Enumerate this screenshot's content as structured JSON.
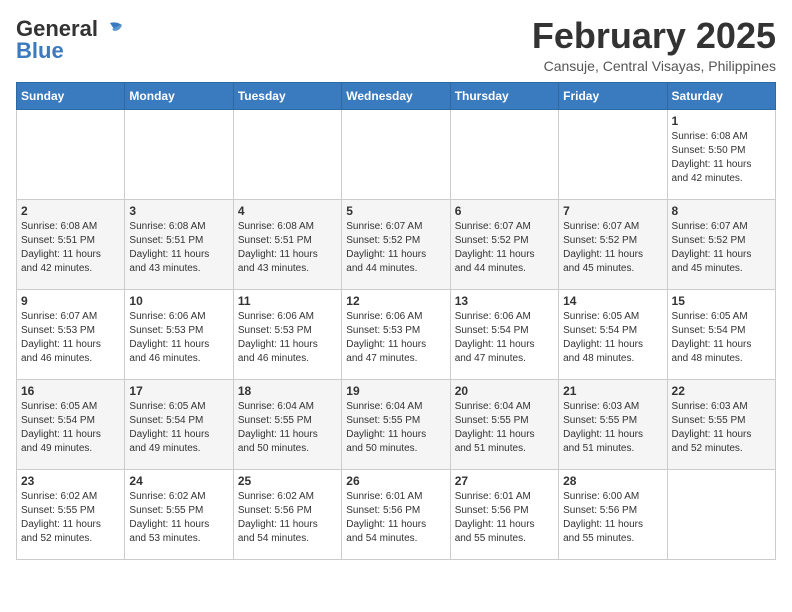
{
  "header": {
    "logo_general": "General",
    "logo_blue": "Blue",
    "month_year": "February 2025",
    "location": "Cansuje, Central Visayas, Philippines"
  },
  "weekdays": [
    "Sunday",
    "Monday",
    "Tuesday",
    "Wednesday",
    "Thursday",
    "Friday",
    "Saturday"
  ],
  "weeks": [
    [
      {
        "day": "",
        "info": ""
      },
      {
        "day": "",
        "info": ""
      },
      {
        "day": "",
        "info": ""
      },
      {
        "day": "",
        "info": ""
      },
      {
        "day": "",
        "info": ""
      },
      {
        "day": "",
        "info": ""
      },
      {
        "day": "1",
        "info": "Sunrise: 6:08 AM\nSunset: 5:50 PM\nDaylight: 11 hours\nand 42 minutes."
      }
    ],
    [
      {
        "day": "2",
        "info": "Sunrise: 6:08 AM\nSunset: 5:51 PM\nDaylight: 11 hours\nand 42 minutes."
      },
      {
        "day": "3",
        "info": "Sunrise: 6:08 AM\nSunset: 5:51 PM\nDaylight: 11 hours\nand 43 minutes."
      },
      {
        "day": "4",
        "info": "Sunrise: 6:08 AM\nSunset: 5:51 PM\nDaylight: 11 hours\nand 43 minutes."
      },
      {
        "day": "5",
        "info": "Sunrise: 6:07 AM\nSunset: 5:52 PM\nDaylight: 11 hours\nand 44 minutes."
      },
      {
        "day": "6",
        "info": "Sunrise: 6:07 AM\nSunset: 5:52 PM\nDaylight: 11 hours\nand 44 minutes."
      },
      {
        "day": "7",
        "info": "Sunrise: 6:07 AM\nSunset: 5:52 PM\nDaylight: 11 hours\nand 45 minutes."
      },
      {
        "day": "8",
        "info": "Sunrise: 6:07 AM\nSunset: 5:52 PM\nDaylight: 11 hours\nand 45 minutes."
      }
    ],
    [
      {
        "day": "9",
        "info": "Sunrise: 6:07 AM\nSunset: 5:53 PM\nDaylight: 11 hours\nand 46 minutes."
      },
      {
        "day": "10",
        "info": "Sunrise: 6:06 AM\nSunset: 5:53 PM\nDaylight: 11 hours\nand 46 minutes."
      },
      {
        "day": "11",
        "info": "Sunrise: 6:06 AM\nSunset: 5:53 PM\nDaylight: 11 hours\nand 46 minutes."
      },
      {
        "day": "12",
        "info": "Sunrise: 6:06 AM\nSunset: 5:53 PM\nDaylight: 11 hours\nand 47 minutes."
      },
      {
        "day": "13",
        "info": "Sunrise: 6:06 AM\nSunset: 5:54 PM\nDaylight: 11 hours\nand 47 minutes."
      },
      {
        "day": "14",
        "info": "Sunrise: 6:05 AM\nSunset: 5:54 PM\nDaylight: 11 hours\nand 48 minutes."
      },
      {
        "day": "15",
        "info": "Sunrise: 6:05 AM\nSunset: 5:54 PM\nDaylight: 11 hours\nand 48 minutes."
      }
    ],
    [
      {
        "day": "16",
        "info": "Sunrise: 6:05 AM\nSunset: 5:54 PM\nDaylight: 11 hours\nand 49 minutes."
      },
      {
        "day": "17",
        "info": "Sunrise: 6:05 AM\nSunset: 5:54 PM\nDaylight: 11 hours\nand 49 minutes."
      },
      {
        "day": "18",
        "info": "Sunrise: 6:04 AM\nSunset: 5:55 PM\nDaylight: 11 hours\nand 50 minutes."
      },
      {
        "day": "19",
        "info": "Sunrise: 6:04 AM\nSunset: 5:55 PM\nDaylight: 11 hours\nand 50 minutes."
      },
      {
        "day": "20",
        "info": "Sunrise: 6:04 AM\nSunset: 5:55 PM\nDaylight: 11 hours\nand 51 minutes."
      },
      {
        "day": "21",
        "info": "Sunrise: 6:03 AM\nSunset: 5:55 PM\nDaylight: 11 hours\nand 51 minutes."
      },
      {
        "day": "22",
        "info": "Sunrise: 6:03 AM\nSunset: 5:55 PM\nDaylight: 11 hours\nand 52 minutes."
      }
    ],
    [
      {
        "day": "23",
        "info": "Sunrise: 6:02 AM\nSunset: 5:55 PM\nDaylight: 11 hours\nand 52 minutes."
      },
      {
        "day": "24",
        "info": "Sunrise: 6:02 AM\nSunset: 5:55 PM\nDaylight: 11 hours\nand 53 minutes."
      },
      {
        "day": "25",
        "info": "Sunrise: 6:02 AM\nSunset: 5:56 PM\nDaylight: 11 hours\nand 54 minutes."
      },
      {
        "day": "26",
        "info": "Sunrise: 6:01 AM\nSunset: 5:56 PM\nDaylight: 11 hours\nand 54 minutes."
      },
      {
        "day": "27",
        "info": "Sunrise: 6:01 AM\nSunset: 5:56 PM\nDaylight: 11 hours\nand 55 minutes."
      },
      {
        "day": "28",
        "info": "Sunrise: 6:00 AM\nSunset: 5:56 PM\nDaylight: 11 hours\nand 55 minutes."
      },
      {
        "day": "",
        "info": ""
      }
    ]
  ]
}
